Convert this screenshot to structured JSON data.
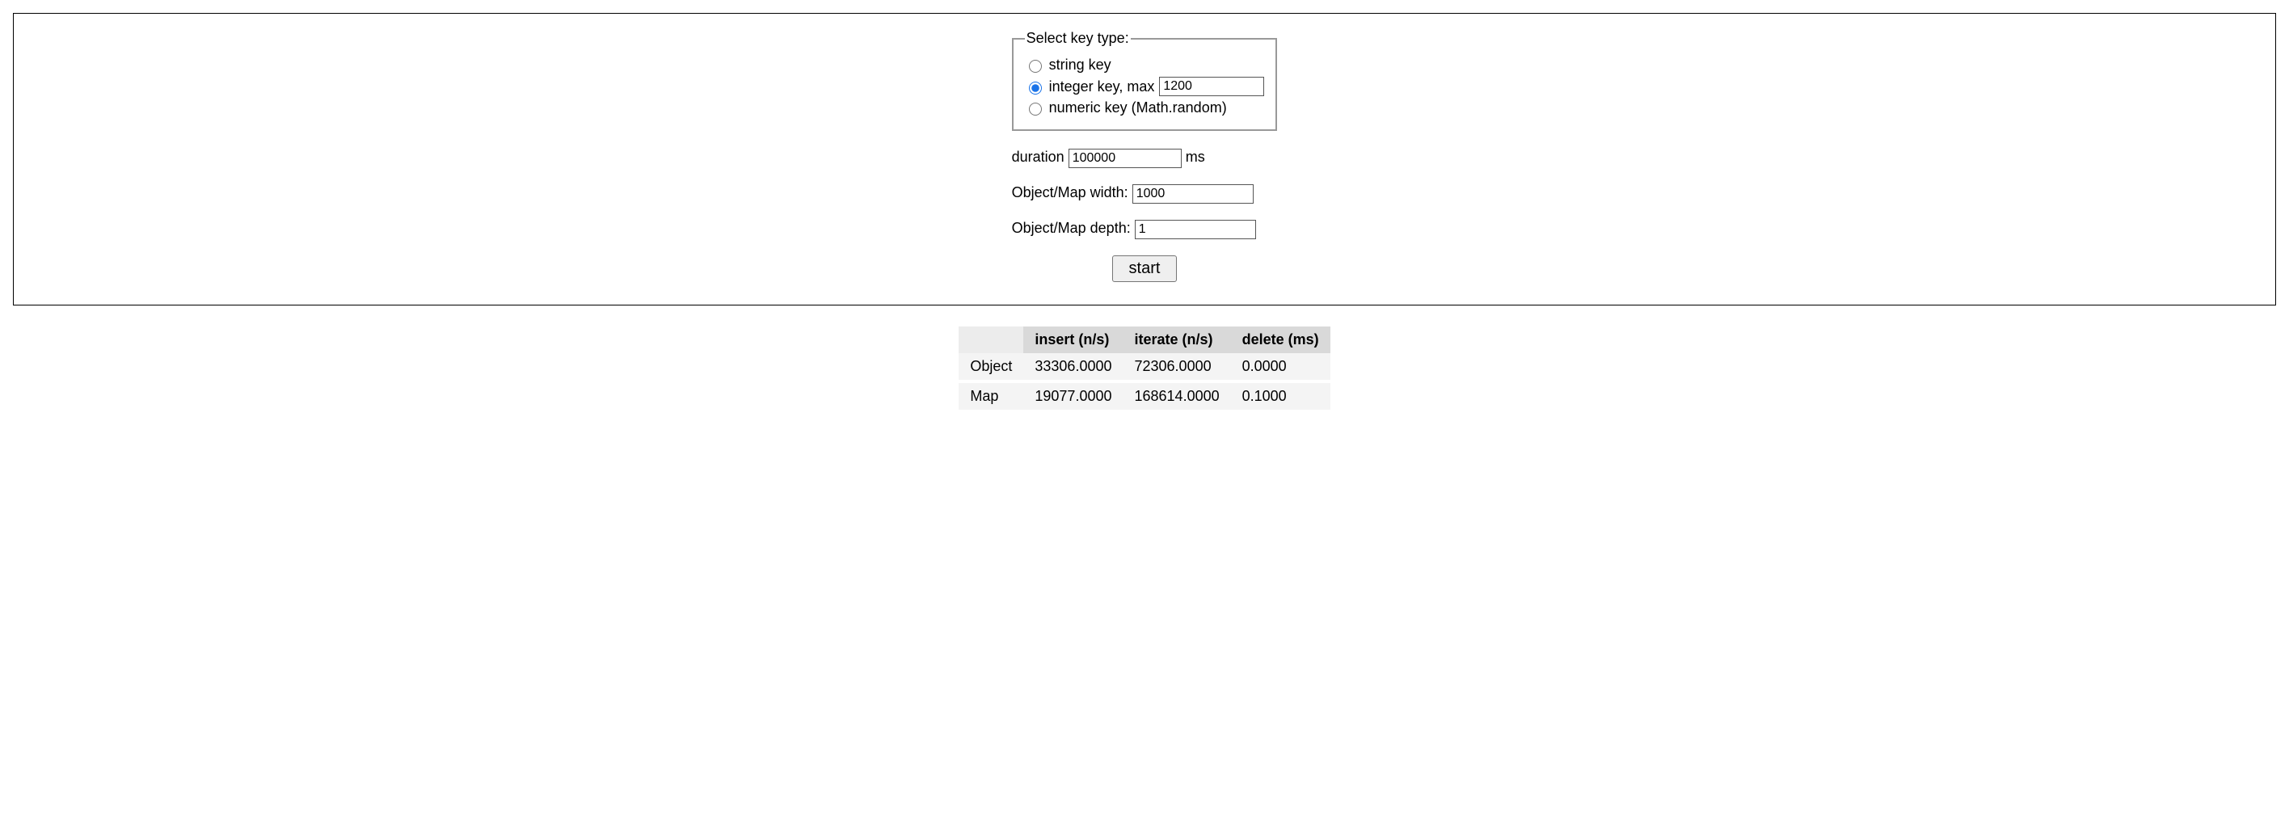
{
  "form": {
    "fieldset_legend": "Select key type:",
    "options": {
      "string": {
        "label": "string key",
        "selected": false
      },
      "integer": {
        "label": "integer key, max",
        "selected": true,
        "max": "1200"
      },
      "numeric": {
        "label": "numeric key (Math.random)",
        "selected": false
      }
    },
    "duration": {
      "label_pre": "duration",
      "value": "100000",
      "label_post": "ms"
    },
    "width": {
      "label": "Object/Map width:",
      "value": "1000"
    },
    "depth": {
      "label": "Object/Map depth:",
      "value": "1"
    },
    "start_label": "start"
  },
  "results": {
    "columns": [
      "insert (n/s)",
      "iterate (n/s)",
      "delete (ms)"
    ],
    "rows": [
      {
        "name": "Object",
        "insert": "33306.0000",
        "iterate": "72306.0000",
        "delete": "0.0000"
      },
      {
        "name": "Map",
        "insert": "19077.0000",
        "iterate": "168614.0000",
        "delete": "0.1000"
      }
    ]
  }
}
